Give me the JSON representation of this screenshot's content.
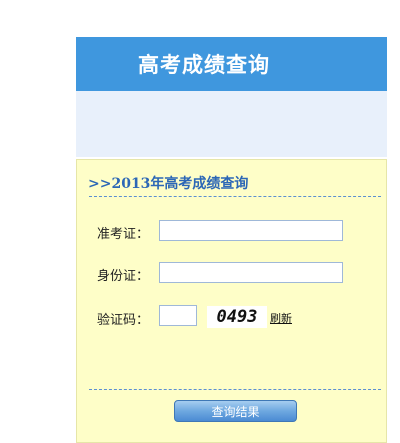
{
  "header": {
    "title": "高考成绩查询"
  },
  "form": {
    "title": ">>2013年高考成绩查询",
    "fields": [
      {
        "label": "准考证：",
        "value": ""
      },
      {
        "label": "身份证：",
        "value": ""
      },
      {
        "label": "验证码：",
        "value": ""
      }
    ],
    "captcha": {
      "code": "0493",
      "refresh_label": "刷新"
    },
    "submit_label": "查询结果"
  },
  "colors": {
    "header_bg": "#3f97de",
    "subheader_bg": "#e8f0fb",
    "form_bg": "#fefec8",
    "form_title": "#2c67b6",
    "dash_line": "#5b8fd1",
    "button_bg": "#4b8bd3"
  }
}
